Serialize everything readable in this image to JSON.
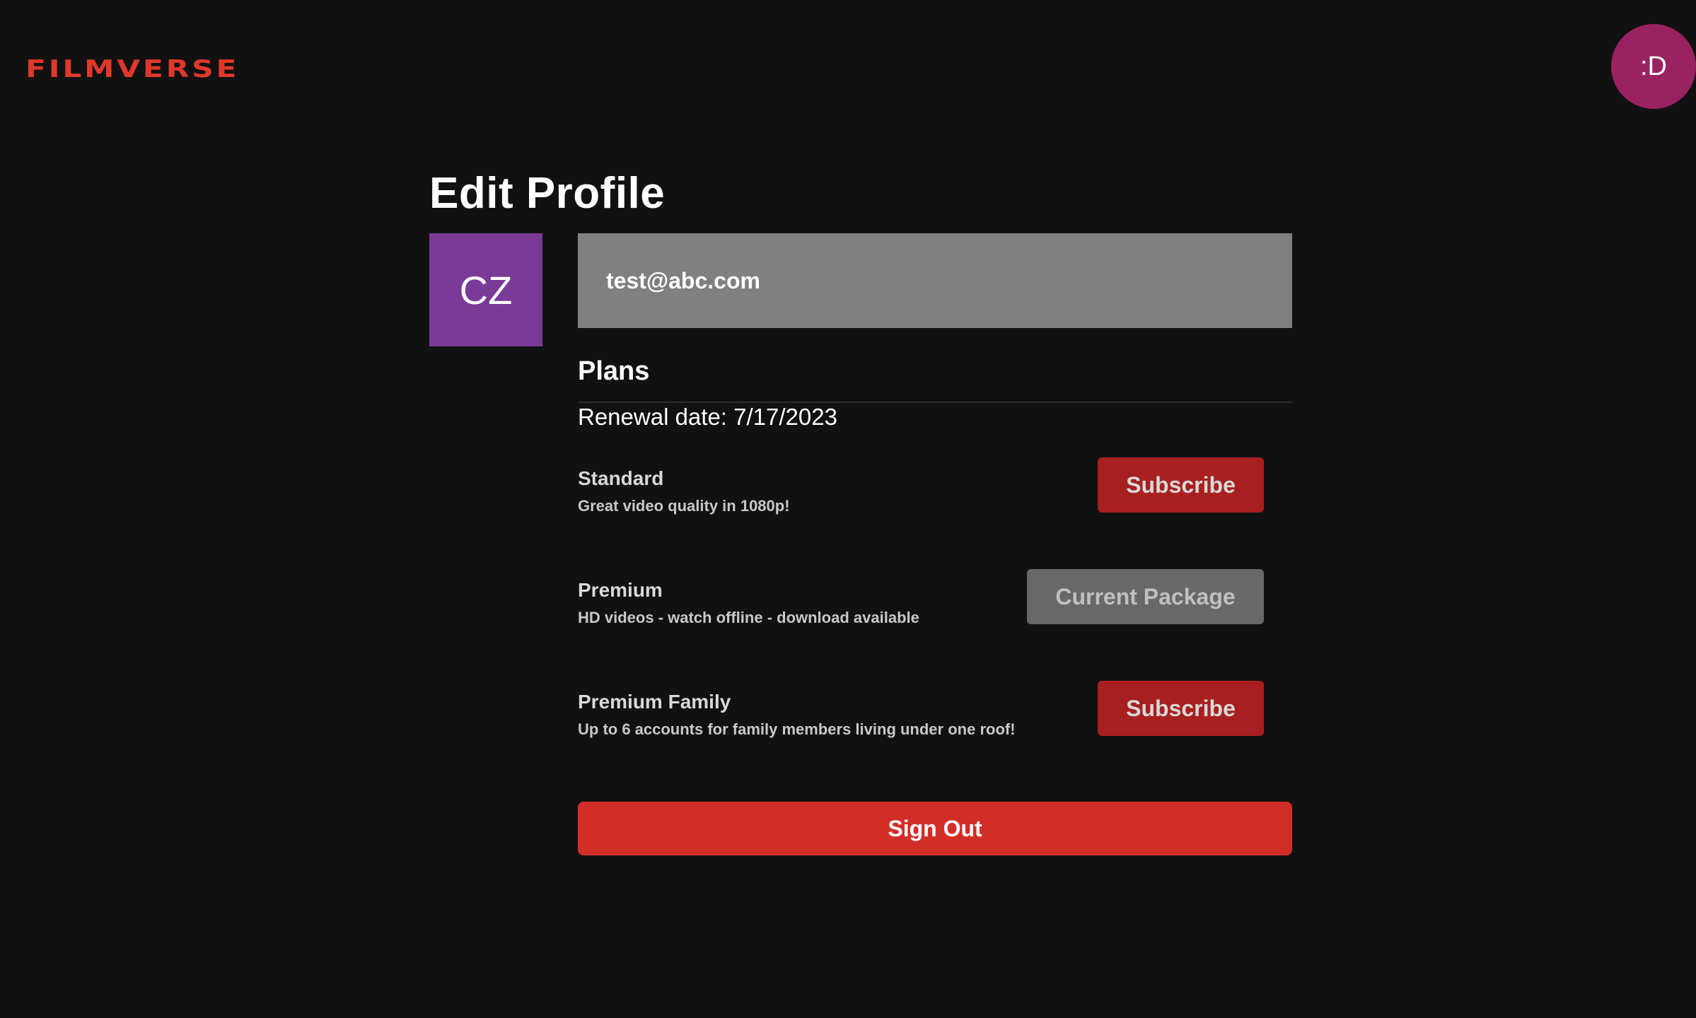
{
  "header": {
    "logo": "FILMVERSE",
    "user_avatar_label": ":D",
    "user_avatar_color": "#9b2260"
  },
  "page": {
    "title": "Edit Profile"
  },
  "profile": {
    "avatar_initials": "CZ",
    "avatar_color": "#7a3a96",
    "email": "test@abc.com"
  },
  "plans": {
    "heading": "Plans",
    "renewal": "Renewal date: 7/17/2023",
    "items": [
      {
        "name": "Standard",
        "description": "Great video quality in 1080p!",
        "button_label": "Subscribe",
        "is_current": false
      },
      {
        "name": "Premium",
        "description": "HD videos - watch offline - download available",
        "button_label": "Current Package",
        "is_current": true
      },
      {
        "name": "Premium Family",
        "description": "Up to 6 accounts for family members living under one roof!",
        "button_label": "Subscribe",
        "is_current": false
      }
    ]
  },
  "actions": {
    "sign_out_label": "Sign Out",
    "sign_out_color": "#d22e28"
  },
  "colors": {
    "background": "#111111",
    "brand": "#e0382a",
    "subscribe": "#a81f1f",
    "current_package": "#686868"
  }
}
